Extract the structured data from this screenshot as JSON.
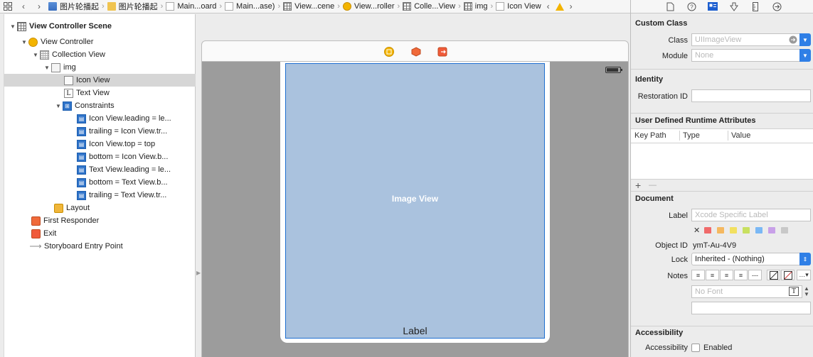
{
  "breadcrumb": [
    {
      "label": "图片轮播起",
      "icon": "file-icon"
    },
    {
      "label": "图片轮播起",
      "icon": "folder-icon"
    },
    {
      "label": "Main...oard",
      "icon": "doc-icon"
    },
    {
      "label": "Main...ase)",
      "icon": "doc-icon"
    },
    {
      "label": "View...cene",
      "icon": "scene-icon"
    },
    {
      "label": "View...roller",
      "icon": "view-controller-icon"
    },
    {
      "label": "Colle...View",
      "icon": "collection-view-icon"
    },
    {
      "label": "img",
      "icon": "cell-icon"
    },
    {
      "label": "Icon View",
      "icon": "image-view-icon"
    }
  ],
  "outline": {
    "scene": "View Controller Scene",
    "items": [
      {
        "label": "View Controller",
        "icon": "view-controller-icon"
      },
      {
        "label": "Collection View",
        "icon": "collection-view-icon"
      },
      {
        "label": "img",
        "icon": "cell-icon"
      },
      {
        "label": "Icon View",
        "icon": "image-view-icon",
        "selected": true
      },
      {
        "label": "Text View",
        "icon": "label-icon"
      },
      {
        "label": "Constraints",
        "icon": "constraints-icon"
      },
      {
        "label": "Icon View.leading = le...",
        "icon": "constraint-icon"
      },
      {
        "label": "trailing = Icon View.tr...",
        "icon": "constraint-icon"
      },
      {
        "label": "Icon View.top = top",
        "icon": "constraint-icon"
      },
      {
        "label": "bottom = Icon View.b...",
        "icon": "constraint-icon"
      },
      {
        "label": "Text View.leading = le...",
        "icon": "constraint-icon"
      },
      {
        "label": "bottom = Text View.b...",
        "icon": "constraint-icon"
      },
      {
        "label": "trailing = Text View.tr...",
        "icon": "constraint-icon"
      },
      {
        "label": "Layout",
        "icon": "layout-icon"
      },
      {
        "label": "First Responder",
        "icon": "first-responder-icon"
      },
      {
        "label": "Exit",
        "icon": "exit-icon"
      },
      {
        "label": "Storyboard Entry Point",
        "icon": "entry-arrow-icon"
      }
    ]
  },
  "canvas": {
    "image_view_label": "Image View",
    "cell_label": "Label"
  },
  "inspector": {
    "custom_class": {
      "title": "Custom Class",
      "class_label": "Class",
      "class_placeholder": "UIImageView",
      "module_label": "Module",
      "module_placeholder": "None"
    },
    "identity": {
      "title": "Identity",
      "restoration_label": "Restoration ID",
      "restoration_value": ""
    },
    "runtime": {
      "title": "User Defined Runtime Attributes",
      "columns": [
        "Key Path",
        "Type",
        "Value"
      ],
      "add": "+",
      "remove": "—"
    },
    "document": {
      "title": "Document",
      "label_label": "Label",
      "label_placeholder": "Xcode Specific Label",
      "clear": "✕",
      "swatches": [
        "#f06a6a",
        "#f5b860",
        "#f2e060",
        "#c8e060",
        "#7ab8f5",
        "#c8a0e8",
        "#c8c8c8"
      ],
      "object_id_label": "Object ID",
      "object_id_value": "ymT-Au-4V9",
      "lock_label": "Lock",
      "lock_value": "Inherited - (Nothing)",
      "notes_label": "Notes",
      "font_placeholder": "No Font"
    },
    "accessibility": {
      "title": "Accessibility",
      "row_label": "Accessibility",
      "enabled_label": "Enabled"
    }
  }
}
